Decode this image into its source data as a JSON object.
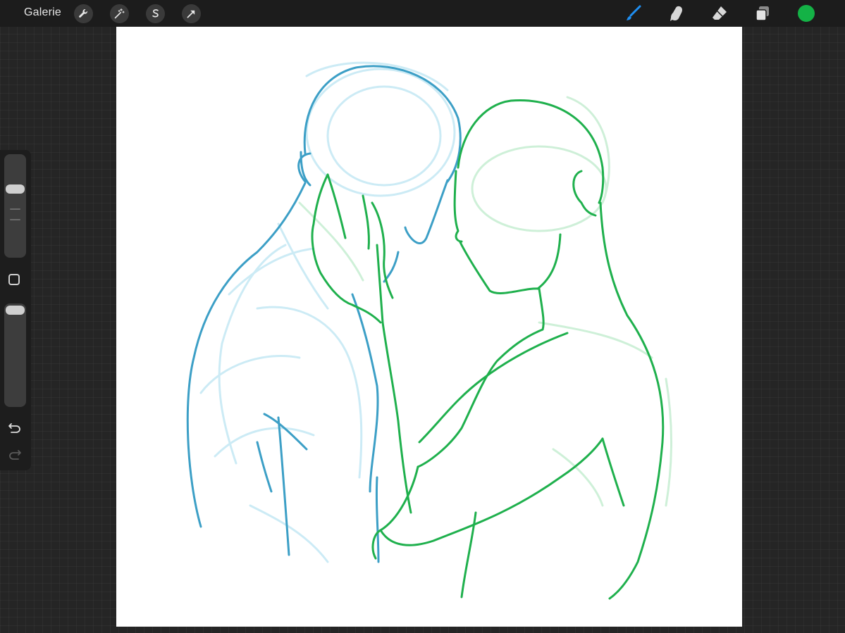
{
  "toolbar": {
    "gallery_label": "Galerie",
    "left_tools": [
      {
        "name": "actions",
        "icon": "wrench-icon"
      },
      {
        "name": "adjustments",
        "icon": "magic-wand-icon"
      },
      {
        "name": "selection",
        "icon": "selection-s-icon"
      },
      {
        "name": "transform",
        "icon": "arrow-cursor-icon"
      }
    ],
    "right_tools": [
      {
        "name": "brush",
        "icon": "brush-icon",
        "active": true
      },
      {
        "name": "smudge",
        "icon": "smudge-finger-icon",
        "active": false
      },
      {
        "name": "eraser",
        "icon": "eraser-icon",
        "active": false
      },
      {
        "name": "layers",
        "icon": "layers-icon",
        "active": false
      }
    ],
    "active_tool_color": "#1f8ff2",
    "current_color": "#14b246"
  },
  "sidebar": {
    "brush_size_level": 0.22,
    "opacity_level": 0.05,
    "modify_button": "square-modify-icon",
    "undo_icon": "undo-arrow-icon",
    "redo_icon": "redo-arrow-icon",
    "redo_enabled": false
  },
  "canvas": {
    "background": "#ffffff",
    "sketch_colors": {
      "blue_figure": "#3ea0c4",
      "blue_faint": "#bfe6f4",
      "green_figure": "#1fb04d",
      "green_faint": "#c9efd3"
    }
  }
}
